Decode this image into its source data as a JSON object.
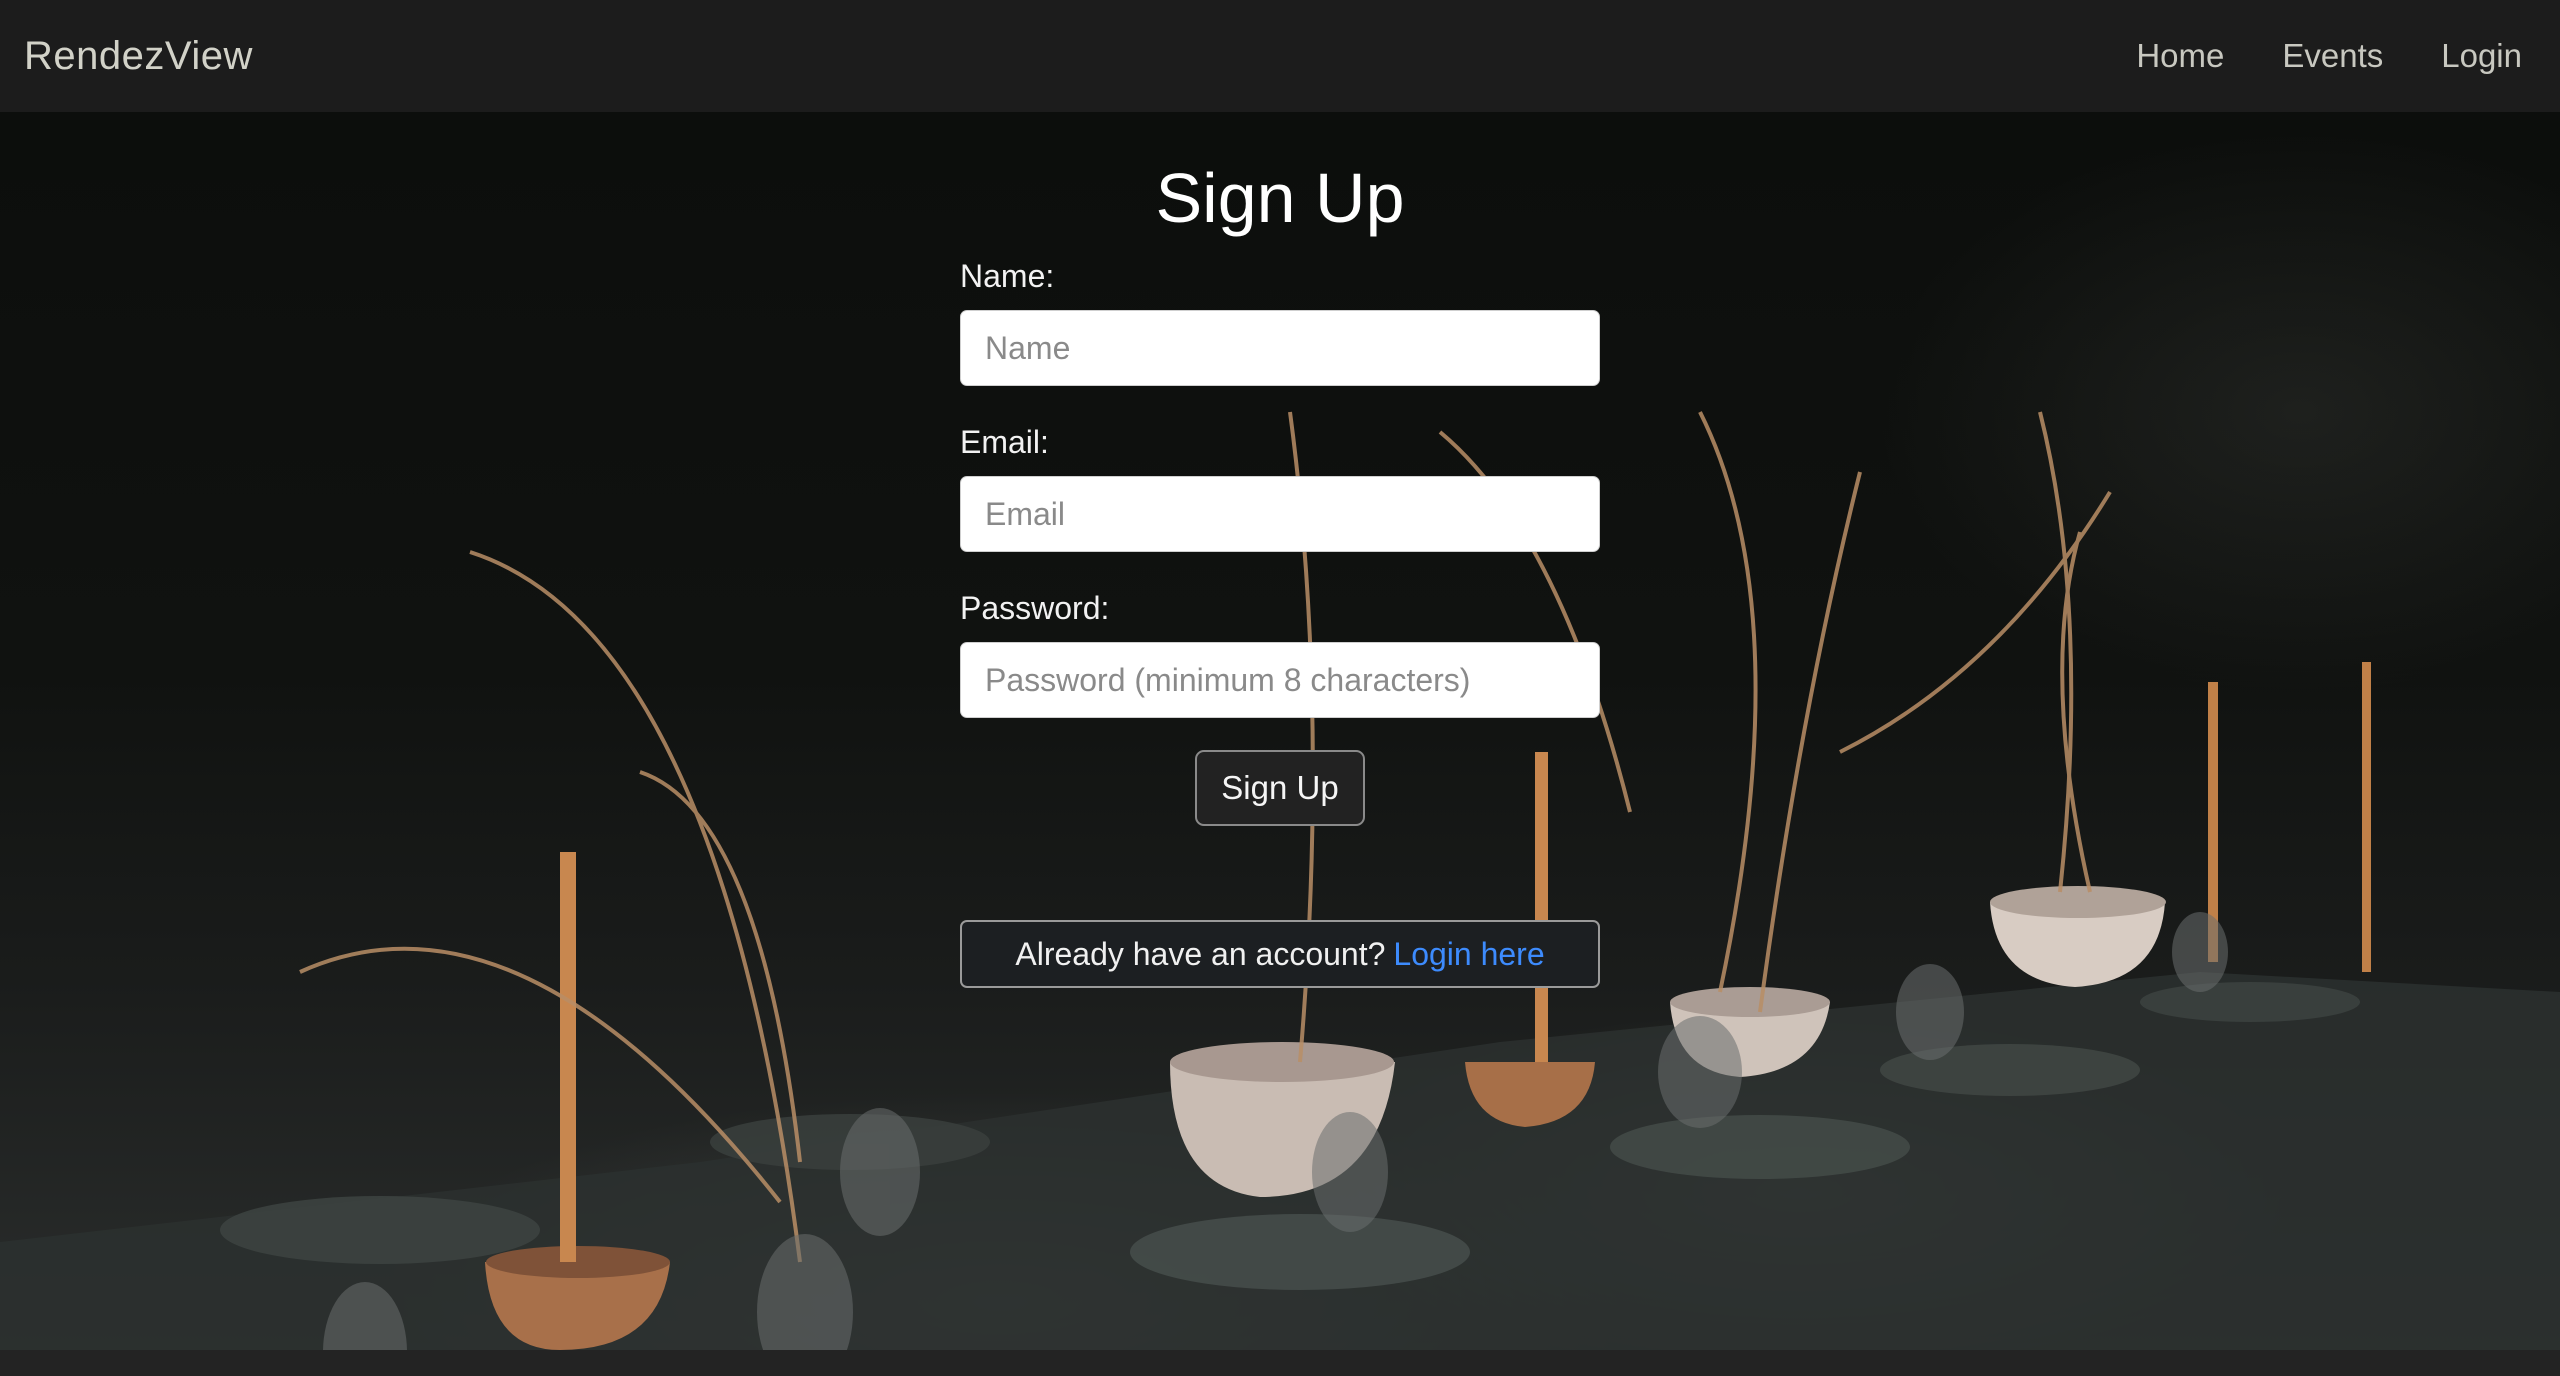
{
  "navbar": {
    "brand": "RendezView",
    "links": [
      {
        "label": "Home"
      },
      {
        "label": "Events"
      },
      {
        "label": "Login"
      }
    ]
  },
  "form": {
    "title": "Sign Up",
    "fields": [
      {
        "label": "Name:",
        "placeholder": "Name",
        "value": ""
      },
      {
        "label": "Email:",
        "placeholder": "Email",
        "value": ""
      },
      {
        "label": "Password:",
        "placeholder": "Password (minimum 8 characters)",
        "value": ""
      }
    ],
    "submit_label": "Sign Up",
    "login_prompt": "Already have an account?",
    "login_link": "Login here"
  },
  "colors": {
    "navbar_bg": "#1c1c1c",
    "link": "#3d8bfd",
    "button_bg": "#222222"
  }
}
